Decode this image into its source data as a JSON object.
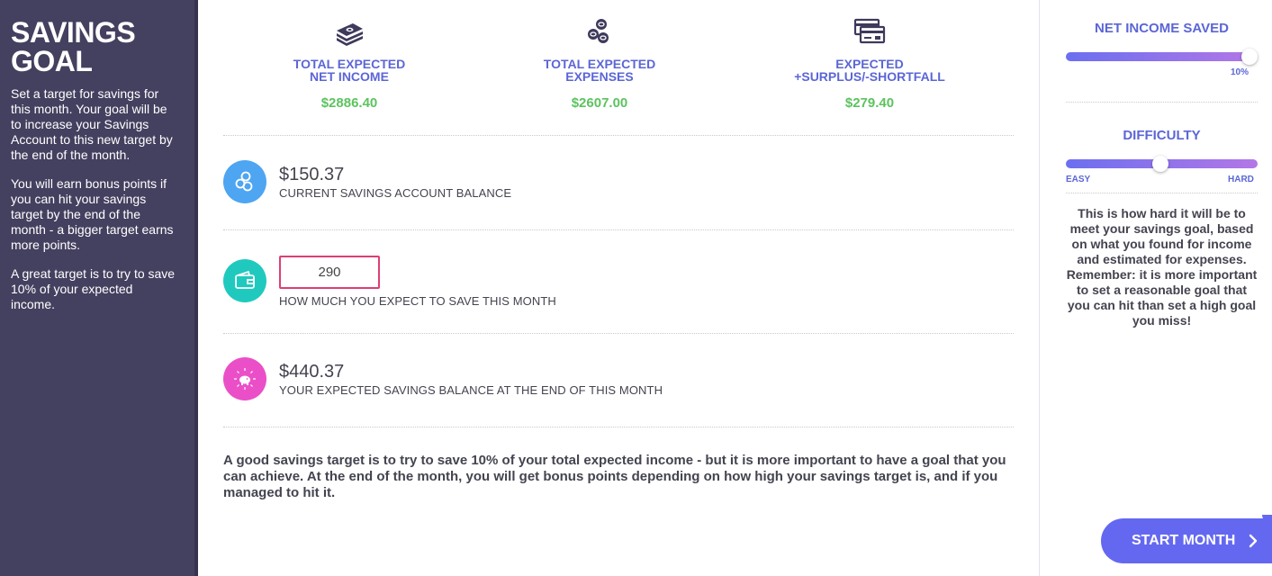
{
  "sidebar": {
    "title": "SAVINGS GOAL",
    "paragraphs": [
      "Set a target for savings for this month. Your goal will be to increase your Savings Account to this new target by the end of the month.",
      "You will earn bonus points if you can hit your savings target by the end of the month - a bigger target earns more points.",
      "A great target is to try to save 10% of your expected income."
    ]
  },
  "summary": {
    "income": {
      "label_line1": "TOTAL EXPECTED",
      "label_line2": "NET INCOME",
      "value": "$2886.40",
      "icon": "money-stack-icon"
    },
    "expenses": {
      "label_line1": "TOTAL EXPECTED",
      "label_line2": "EXPENSES",
      "value": "$2607.00",
      "icon": "coins-icon"
    },
    "surplus": {
      "label_line1": "EXPECTED",
      "label_line2": "+SURPLUS/-SHORTFALL",
      "value": "$279.40",
      "icon": "credit-card-icon"
    }
  },
  "rows": {
    "current": {
      "value": "$150.37",
      "label": "CURRENT SAVINGS ACCOUNT BALANCE",
      "icon": "coins-icon"
    },
    "expect": {
      "input_value": "290",
      "label": "HOW MUCH YOU EXPECT TO SAVE THIS MONTH",
      "icon": "wallet-icon"
    },
    "projected": {
      "value": "$440.37",
      "label": "YOUR EXPECTED SAVINGS BALANCE AT THE END OF THIS MONTH",
      "icon": "piggy-bank-icon"
    }
  },
  "footer_text": "A good savings target is to try to save 10% of your total expected income - but it is more important to have a goal that you can achieve. At the end of the month, you will get bonus points depending on how high your savings target is, and if you managed to hit it.",
  "right_panel": {
    "net_income_title": "NET INCOME SAVED",
    "net_income_percent_label": "10%",
    "net_income_fraction": 1.0,
    "difficulty_title": "DIFFICULTY",
    "difficulty_easy": "EASY",
    "difficulty_hard": "HARD",
    "difficulty_fraction": 0.49,
    "description": "This is how hard it will be to meet your savings goal, based on what you found for income and estimated for expenses. Remember: it is more important to set a reasonable goal that you can hit than set a high goal you miss!",
    "start_button": "START MONTH"
  },
  "colors": {
    "sidebar_bg": "#44405f",
    "accent_blue": "#5b66d6",
    "money_green": "#5cc35f",
    "input_border": "#dd3f72",
    "circle_blue": "#4ea5f2",
    "circle_teal": "#20c9be",
    "circle_pink": "#ea4fc8",
    "button": "#6468f0"
  }
}
